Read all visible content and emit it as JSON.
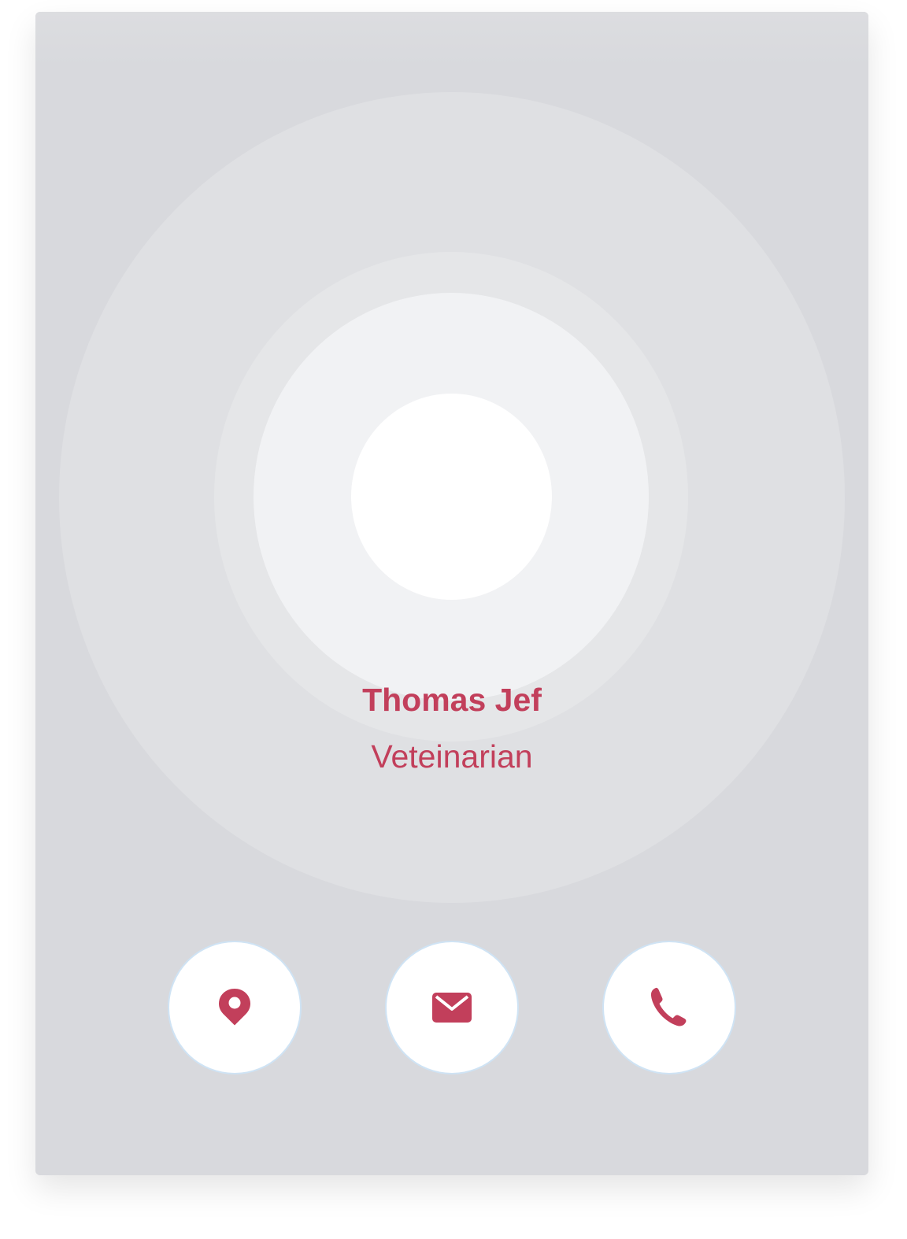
{
  "profile": {
    "name": "Thomas Jef",
    "role": "Veteinarian"
  },
  "actions": [
    {
      "id": "location",
      "icon": "map-pin-icon"
    },
    {
      "id": "email",
      "icon": "envelope-icon"
    },
    {
      "id": "phone",
      "icon": "phone-icon"
    }
  ],
  "colors": {
    "accent": "#c23f5b",
    "card_background": "#d8d9dd",
    "button_background": "#ffffff"
  }
}
